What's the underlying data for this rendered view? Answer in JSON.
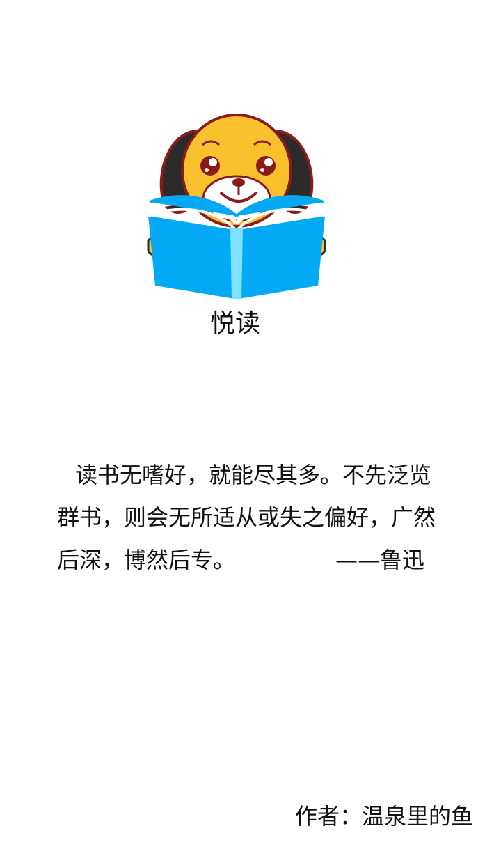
{
  "splash": {
    "logo_icon": "dog-reading-book-icon",
    "app_name": "悦读",
    "quote": {
      "line1": "读书无嗜好，就能尽其多。不先泛览",
      "line2": "群书，则会无所适从或失之偏好，广然",
      "line3": "后深，博然后专。",
      "attribution": "——鲁迅"
    },
    "author": "作者：温泉里的鱼"
  },
  "colors": {
    "face": "#F9C12E",
    "ears": "#2B2B2B",
    "outline": "#8B1A1A",
    "book": "#03A9F4",
    "book_spine": "#7FE3FF"
  }
}
